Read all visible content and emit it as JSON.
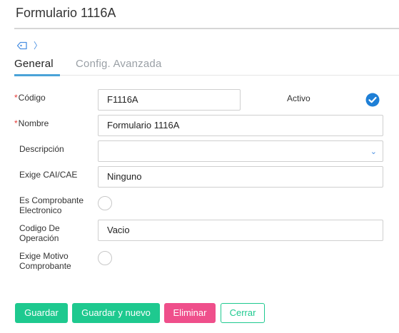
{
  "window": {
    "title": "Formulario 1116A"
  },
  "breadcrumb": {
    "tag_icon": "tag-icon",
    "separator": "〉"
  },
  "tabs": [
    {
      "label": "General",
      "active": true
    },
    {
      "label": "Config. Avanzada",
      "active": false
    }
  ],
  "form": {
    "required_marker": "*",
    "codigo": {
      "label": "Código",
      "value": "F1116A",
      "required": true
    },
    "activo": {
      "label": "Activo",
      "checked": true
    },
    "nombre": {
      "label": "Nombre",
      "value": "Formulario 1116A",
      "required": true
    },
    "descripcion": {
      "label": "Descripción",
      "value": "",
      "caret": "⌄"
    },
    "exige_cai": {
      "label": "Exige CAI/CAE",
      "value": "Ninguno"
    },
    "es_comprobante": {
      "label_line1": "Es Comprobante",
      "label_line2": "Electronico",
      "checked": false
    },
    "codigo_operacion": {
      "label_line1": "Codigo De",
      "label_line2": "Operación",
      "value": "Vacio"
    },
    "exige_motivo": {
      "label_line1": "Exige Motivo",
      "label_line2": "Comprobante",
      "checked": false
    }
  },
  "actions": {
    "save": "Guardar",
    "save_new": "Guardar y nuevo",
    "delete": "Eliminar",
    "close": "Cerrar"
  },
  "colors": {
    "accent_green": "#1ec98f",
    "danger_pink": "#ef4f8b",
    "link_blue": "#4a90e2",
    "tab_underline": "#4aa3d8",
    "required_red": "#e53935"
  }
}
